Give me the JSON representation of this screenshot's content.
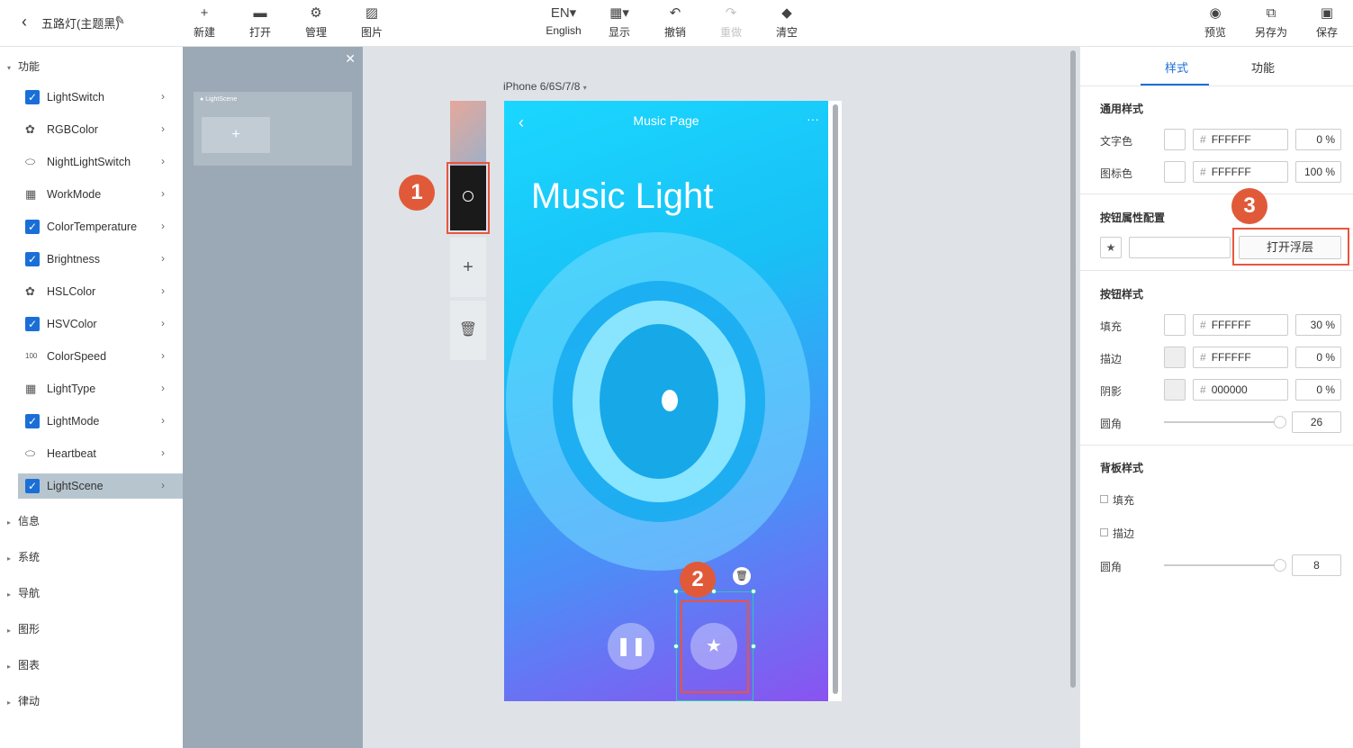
{
  "header": {
    "title": "五路灯(主题黑)",
    "toolbar": [
      {
        "icon": "plus-icon",
        "glyph": "+",
        "label": "新建",
        "disabled": false
      },
      {
        "icon": "folder-icon",
        "glyph": "▬",
        "label": "打开",
        "disabled": false
      },
      {
        "icon": "gear-icon",
        "glyph": "⚙",
        "label": "管理",
        "disabled": false
      },
      {
        "icon": "image-icon",
        "glyph": "▨",
        "label": "图片",
        "disabled": false
      },
      {
        "icon": "language-icon",
        "glyph": "EN▾",
        "label": "English",
        "disabled": false
      },
      {
        "icon": "display-icon",
        "glyph": "▦▾",
        "label": "显示",
        "disabled": false
      },
      {
        "icon": "undo-icon",
        "glyph": "↶",
        "label": "撤销",
        "disabled": false
      },
      {
        "icon": "redo-icon",
        "glyph": "↷",
        "label": "重做",
        "disabled": true
      },
      {
        "icon": "eraser-icon",
        "glyph": "◆",
        "label": "清空",
        "disabled": false
      },
      {
        "icon": "eye-icon",
        "glyph": "◉",
        "label": "预览",
        "disabled": false
      },
      {
        "icon": "save-as-icon",
        "glyph": "⧉",
        "label": "另存为",
        "disabled": false
      },
      {
        "icon": "save-icon",
        "glyph": "▣",
        "label": "保存",
        "disabled": false
      }
    ]
  },
  "sidebar": {
    "group_label": "功能",
    "items": [
      {
        "label": "LightSwitch",
        "icon": "checkbox-checked-icon",
        "glyph": "✓"
      },
      {
        "label": "RGBColor",
        "icon": "palette-icon",
        "glyph": "✿"
      },
      {
        "label": "NightLightSwitch",
        "icon": "toggle-icon",
        "glyph": "⬭"
      },
      {
        "label": "WorkMode",
        "icon": "grid-icon",
        "glyph": "▦"
      },
      {
        "label": "ColorTemperature",
        "icon": "checkbox-checked-icon",
        "glyph": "✓"
      },
      {
        "label": "Brightness",
        "icon": "checkbox-checked-icon",
        "glyph": "✓"
      },
      {
        "label": "HSLColor",
        "icon": "palette-icon",
        "glyph": "✿"
      },
      {
        "label": "HSVColor",
        "icon": "checkbox-checked-icon",
        "glyph": "✓"
      },
      {
        "label": "ColorSpeed",
        "icon": "number-box-icon",
        "glyph": "100"
      },
      {
        "label": "LightType",
        "icon": "grid-icon",
        "glyph": "▦"
      },
      {
        "label": "LightMode",
        "icon": "checkbox-checked-icon",
        "glyph": "✓"
      },
      {
        "label": "Heartbeat",
        "icon": "toggle-icon",
        "glyph": "⬭"
      },
      {
        "label": "LightScene",
        "icon": "checkbox-checked-icon",
        "glyph": "✓"
      }
    ],
    "categories": [
      "信息",
      "系统",
      "导航",
      "图形",
      "图表",
      "律动"
    ]
  },
  "scene_panel": {
    "card_label": "LightScene",
    "add_glyph": "+"
  },
  "canvas": {
    "device_label": "iPhone 6/6S/7/8",
    "badges": [
      "1",
      "2",
      "3"
    ]
  },
  "phone": {
    "nav_title": "Music Page",
    "big_title": "Music Light"
  },
  "right_panel": {
    "tabs": [
      "样式",
      "功能"
    ],
    "general_title": "通用样式",
    "text_color": {
      "label": "文字色",
      "hex": "FFFFFF",
      "pct": "0 %"
    },
    "icon_color": {
      "label": "图标色",
      "hex": "FFFFFF",
      "pct": "100 %"
    },
    "btn_attr_title": "按钮属性配置",
    "open_layer_label": "打开浮层",
    "btn_style_title": "按钮样式",
    "fill": {
      "label": "填充",
      "hex": "FFFFFF",
      "pct": "30 %"
    },
    "stroke": {
      "label": "描边",
      "hex": "FFFFFF",
      "pct": "0 %"
    },
    "shadow": {
      "label": "阴影",
      "hex": "000000",
      "pct": "0 %"
    },
    "radius": {
      "label": "圆角",
      "value": "26"
    },
    "bg_title": "背板样式",
    "bg_fill_label": "填充",
    "bg_stroke_label": "描边",
    "bg_radius": {
      "label": "圆角",
      "value": "8"
    }
  }
}
